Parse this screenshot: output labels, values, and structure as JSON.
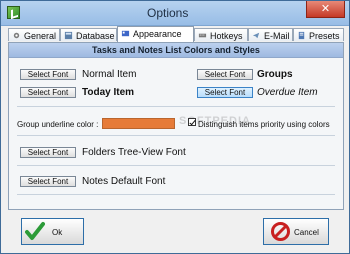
{
  "window": {
    "title": "Options"
  },
  "tabs": [
    {
      "label": "General",
      "icon": "gear-icon"
    },
    {
      "label": "Database",
      "icon": "database-icon"
    },
    {
      "label": "Appearance",
      "icon": "appearance-icon"
    },
    {
      "label": "Hotkeys",
      "icon": "keyboard-icon"
    },
    {
      "label": "E-Mail",
      "icon": "email-icon"
    },
    {
      "label": "Presets",
      "icon": "presets-icon"
    }
  ],
  "section": {
    "title": "Tasks and Notes List Colors and Styles"
  },
  "buttons": {
    "select_font": "Select Font",
    "ok": "Ok",
    "cancel": "Cancel"
  },
  "items": {
    "normal": "Normal Item",
    "today": "Today Item",
    "groups": "Groups",
    "overdue": "Overdue Item",
    "group_underline": "Group underline color :",
    "distinguish": "Distinguish items priority using colors",
    "folders_font": "Folders Tree-View Font",
    "notes_font": "Notes Default Font"
  },
  "watermark": "SOFTPEDIA",
  "colors": {
    "group_underline_color": "#e67b38",
    "active_button": "#b9ddfb",
    "header": "#aec7ea"
  }
}
